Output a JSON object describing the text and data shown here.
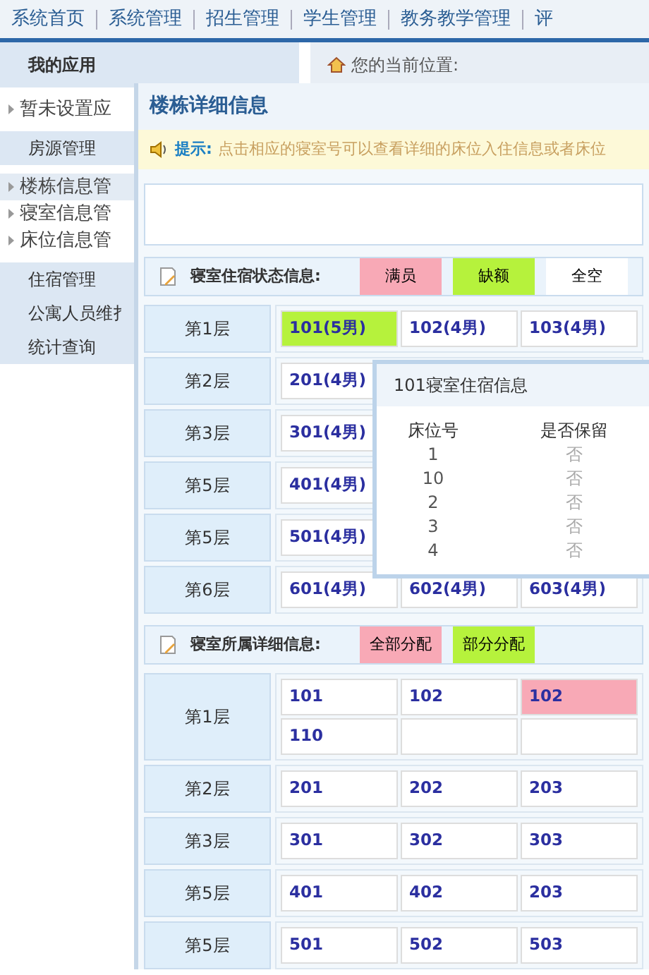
{
  "nav": [
    "系统首页",
    "系统管理",
    "招生管理",
    "学生管理",
    "教务教学管理",
    "评"
  ],
  "sidebar": {
    "header": "我的应用",
    "sections": [
      {
        "items": [
          {
            "label": "暂未设置应",
            "selected": false
          }
        ]
      },
      {
        "title": "房源管理",
        "items": [
          {
            "label": "楼栋信息管",
            "selected": true
          },
          {
            "label": "寝室信息管",
            "selected": false
          },
          {
            "label": "床位信息管",
            "selected": false
          }
        ]
      },
      {
        "title": "住宿管理"
      },
      {
        "title": "公寓人员维扌"
      },
      {
        "title": "统计查询"
      }
    ]
  },
  "breadcrumb": "您的当前位置:",
  "dialog": {
    "title": "楼栋详细信息",
    "tip_label": "提示:",
    "tip": "点击相应的寝室号可以查看详细的床位入住信息或者床位",
    "occupancy": {
      "title": "寝室住宿状态信息:",
      "legend": [
        {
          "label": "满员",
          "color": "#f8a9b6"
        },
        {
          "label": "缺额",
          "color": "#b6f23c"
        },
        {
          "label": "全空",
          "color": "#ffffff"
        }
      ],
      "floors": [
        {
          "label": "第1层",
          "lines": [
            [
              {
                "text": "101(5男)",
                "color": "#b6f23c"
              },
              {
                "text": "102(4男)",
                "color": "#ffffff"
              },
              {
                "text": "103(4男)",
                "color": "#ffffff"
              }
            ]
          ]
        },
        {
          "label": "第2层",
          "lines": [
            [
              {
                "text": "201(4男)",
                "color": "#ffffff"
              }
            ]
          ]
        },
        {
          "label": "第3层",
          "lines": [
            [
              {
                "text": "301(4男)",
                "color": "#ffffff"
              }
            ]
          ]
        },
        {
          "label": "第5层",
          "lines": [
            [
              {
                "text": "401(4男)",
                "color": "#ffffff"
              }
            ]
          ]
        },
        {
          "label": "第5层",
          "lines": [
            [
              {
                "text": "501(4男)",
                "color": "#ffffff"
              }
            ]
          ]
        },
        {
          "label": "第6层",
          "lines": [
            [
              {
                "text": "601(4男)",
                "color": "#ffffff"
              },
              {
                "text": "602(4男)",
                "color": "#ffffff"
              },
              {
                "text": "603(4男)",
                "color": "#ffffff"
              }
            ]
          ]
        }
      ]
    },
    "assignment": {
      "title": "寝室所属详细信息:",
      "legend": [
        {
          "label": "全部分配",
          "color": "#f8a9b6"
        },
        {
          "label": "部分分配",
          "color": "#b6f23c"
        }
      ],
      "floors": [
        {
          "label": "第1层",
          "lines": [
            [
              {
                "text": "101",
                "color": "#ffffff"
              },
              {
                "text": "102",
                "color": "#ffffff"
              },
              {
                "text": "102",
                "color": "#f8a9b6"
              }
            ],
            [
              {
                "text": "110",
                "color": "#ffffff"
              }
            ]
          ]
        },
        {
          "label": "第2层",
          "lines": [
            [
              {
                "text": "201",
                "color": "#ffffff"
              },
              {
                "text": "202",
                "color": "#ffffff"
              },
              {
                "text": "203",
                "color": "#ffffff"
              }
            ]
          ]
        },
        {
          "label": "第3层",
          "lines": [
            [
              {
                "text": "301",
                "color": "#ffffff"
              },
              {
                "text": "302",
                "color": "#ffffff"
              },
              {
                "text": "303",
                "color": "#ffffff"
              }
            ]
          ]
        },
        {
          "label": "第5层",
          "lines": [
            [
              {
                "text": "401",
                "color": "#ffffff"
              },
              {
                "text": "402",
                "color": "#ffffff"
              },
              {
                "text": "203",
                "color": "#ffffff"
              }
            ]
          ]
        },
        {
          "label": "第5层",
          "lines": [
            [
              {
                "text": "501",
                "color": "#ffffff"
              },
              {
                "text": "502",
                "color": "#ffffff"
              },
              {
                "text": "503",
                "color": "#ffffff"
              }
            ]
          ]
        }
      ]
    },
    "popup": {
      "title": "101寝室住宿信息",
      "columns": [
        "床位号",
        "是否保留"
      ],
      "rows": [
        [
          "1",
          "否"
        ],
        [
          "10",
          "否"
        ],
        [
          "2",
          "否"
        ],
        [
          "3",
          "否"
        ],
        [
          "4",
          "否"
        ]
      ]
    }
  }
}
